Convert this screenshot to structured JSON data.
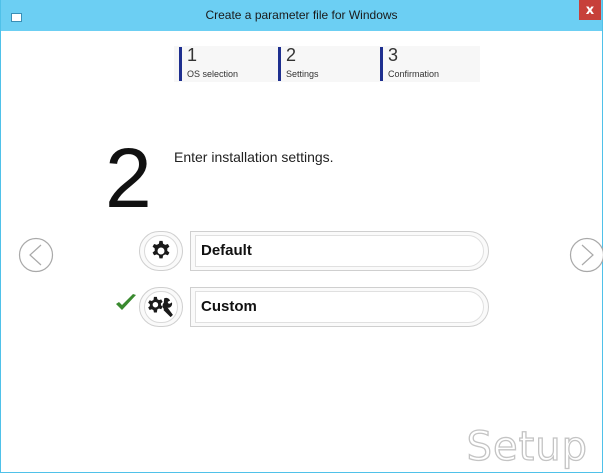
{
  "window": {
    "title": "Create a parameter file for Windows",
    "close_label": "x"
  },
  "steps": [
    {
      "num": "1",
      "label": "OS selection"
    },
    {
      "num": "2",
      "label": "Settings"
    },
    {
      "num": "3",
      "label": "Confirmation"
    }
  ],
  "main": {
    "step_number": "2",
    "heading": "Enter installation settings."
  },
  "options": [
    {
      "label": "Default",
      "icon": "gear-icon",
      "selected": false
    },
    {
      "label": "Custom",
      "icon": "tools-icon",
      "selected": true
    }
  ],
  "watermark": "Setup",
  "colors": {
    "titlebar": "#6ccff3",
    "step_bar": "#1e2f8f",
    "check": "#3a8a2f",
    "close": "#c7403a"
  }
}
